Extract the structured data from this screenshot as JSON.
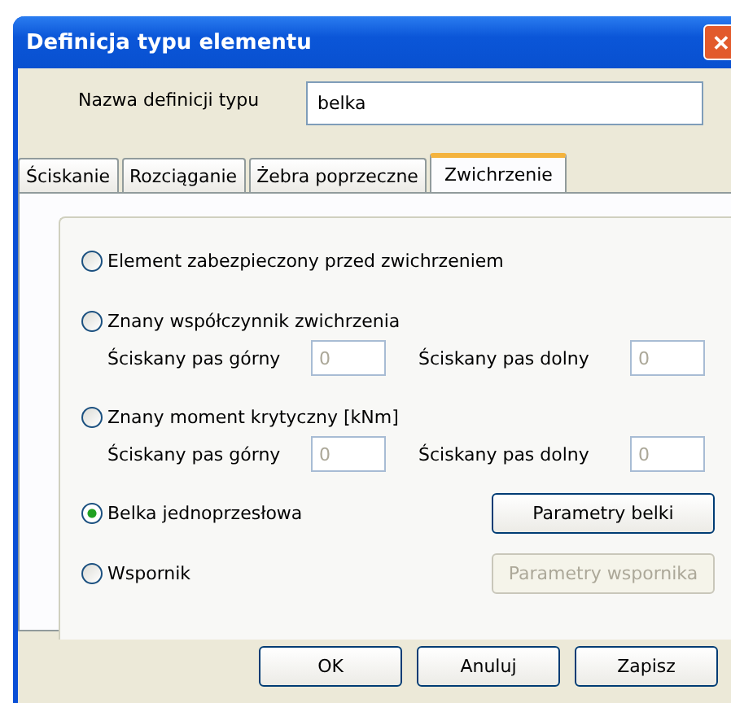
{
  "window": {
    "title": "Definicja typu elementu",
    "close": "✕"
  },
  "name_field": {
    "label": "Nazwa definicji typu",
    "value": "belka"
  },
  "tabs": [
    {
      "label": "Ściskanie",
      "selected": false
    },
    {
      "label": "Rozciąganie",
      "selected": false
    },
    {
      "label": "Żebra poprzeczne",
      "selected": false
    },
    {
      "label": "Zwichrzenie",
      "selected": true
    }
  ],
  "options": [
    {
      "kind": "plain",
      "label": "Element zabezpieczony przed zwichrzeniem",
      "selected": false
    },
    {
      "kind": "inputs",
      "label": "Znany współczynnik zwichrzenia",
      "selected": false,
      "inputs": [
        {
          "label": "Ściskany pas górny",
          "value": "0",
          "disabled": true
        },
        {
          "label": "Ściskany pas dolny",
          "value": "0",
          "disabled": true
        }
      ]
    },
    {
      "kind": "inputs",
      "label": "Znany  moment krytyczny [kNm]",
      "selected": false,
      "inputs": [
        {
          "label": "Ściskany pas górny",
          "value": "0",
          "disabled": true
        },
        {
          "label": "Ściskany pas dolny",
          "value": "0",
          "disabled": true
        }
      ]
    },
    {
      "kind": "button",
      "label": "Belka jednoprzesłowa",
      "selected": true,
      "button": {
        "label": "Parametry belki",
        "disabled": false
      }
    },
    {
      "kind": "button",
      "label": "Wspornik",
      "selected": false,
      "button": {
        "label": "Parametry wspornika",
        "disabled": true
      }
    }
  ],
  "buttons": [
    "OK",
    "Anuluj",
    "Zapisz"
  ]
}
